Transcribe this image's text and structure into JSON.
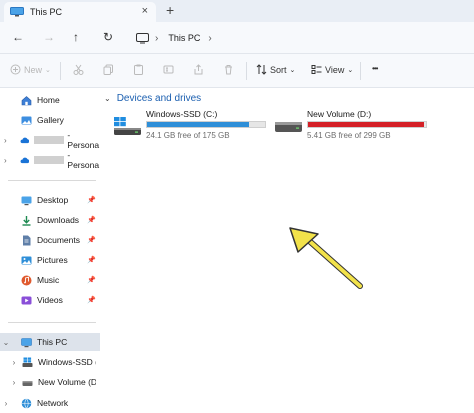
{
  "window": {
    "tab_title": "This PC",
    "new_tab_glyph": "+",
    "close_glyph": "×"
  },
  "address": {
    "breadcrumb": "This PC"
  },
  "toolbar": {
    "new_label": "New",
    "sort_label": "Sort",
    "view_label": "View",
    "more_glyph": "•••"
  },
  "sidebar": {
    "home": "Home",
    "gallery": "Gallery",
    "onedrive_1": "- Persona",
    "onedrive_2": "- Persona",
    "desktop": "Desktop",
    "downloads": "Downloads",
    "documents": "Documents",
    "pictures": "Pictures",
    "music": "Music",
    "videos": "Videos",
    "this_pc": "This PC",
    "drive_c": "Windows-SSD (C:)",
    "drive_d": "New Volume (D:)",
    "network": "Network"
  },
  "main": {
    "group_title": "Devices and drives",
    "drives": [
      {
        "name": "Windows-SSD (C:)",
        "free_text": "24.1 GB free of 175 GB",
        "used_fraction": 0.862,
        "bar_color": "#2f8fd8"
      },
      {
        "name": "New Volume (D:)",
        "free_text": "5.41 GB free of 299 GB",
        "used_fraction": 0.982,
        "bar_color": "#d42027"
      }
    ]
  },
  "colors": {
    "accent": "#1b5fb0",
    "annotation_arrow": "#f2e24a"
  }
}
